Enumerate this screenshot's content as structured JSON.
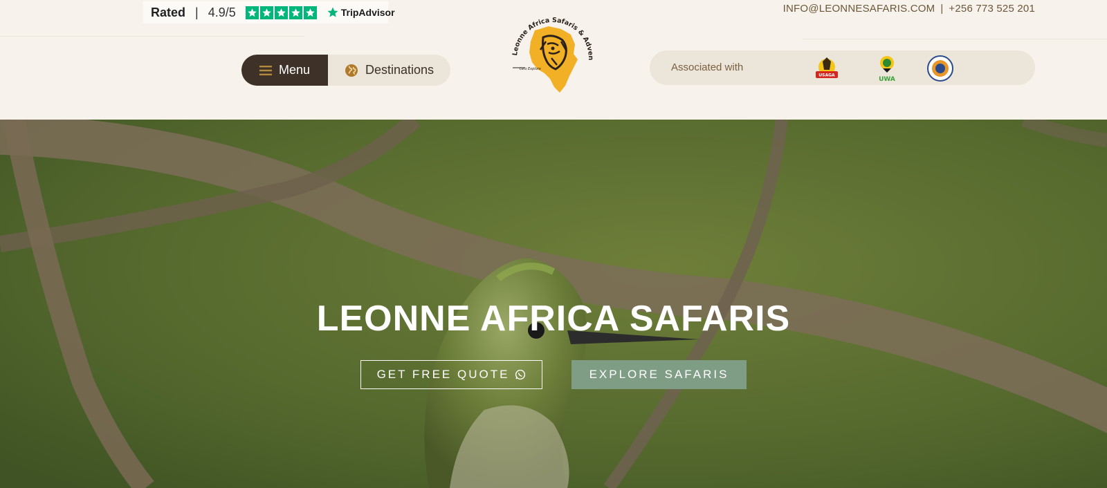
{
  "rating": {
    "rated_label": "Rated",
    "separator": "|",
    "score": "4.9/5",
    "stars": 5,
    "provider": "TripAdvisor",
    "star_color": "#00b67a"
  },
  "contact": {
    "email": "INFO@LEONNESAFARIS.COM",
    "separator": "|",
    "phone": "+256 773 525 201"
  },
  "nav": {
    "menu_label": "Menu",
    "destinations_label": "Destinations",
    "menu_icon": "hamburger-icon",
    "destinations_icon": "globe-icon"
  },
  "logo": {
    "brand_text": "Leonne Africa Safaris & Adventures",
    "tagline": "Lets Explore"
  },
  "associations": {
    "label": "Associated with",
    "logos": [
      "USAGA",
      "UWA",
      "Uganda Tourism Association"
    ]
  },
  "hero": {
    "title": "LEONNE AFRICA SAFARIS",
    "quote_button": "GET FREE QUOTE",
    "explore_button": "EXPLORE SAFARIS",
    "quote_icon": "whatsapp-icon"
  },
  "colors": {
    "header_bg": "#f7f3ec",
    "menu_bg": "#3e3228",
    "explore_bg": "#7f9d84",
    "accent_text": "#6b5638"
  }
}
